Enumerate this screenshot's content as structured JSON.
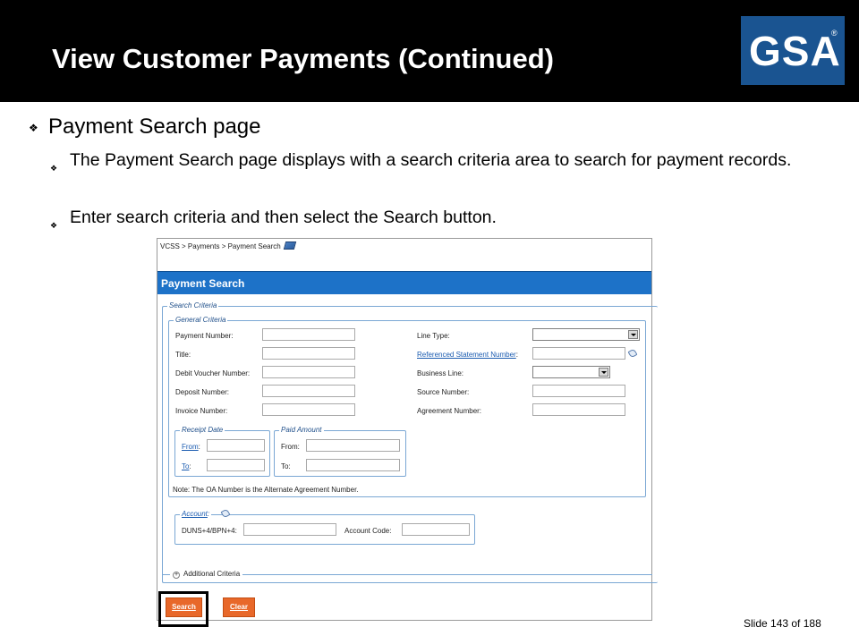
{
  "slide": {
    "title": "View Customer Payments (Continued)",
    "logo_text": "GSA",
    "logo_mark": "®",
    "bullet_main": "Payment Search page",
    "bullet_sub1": "The Payment Search page displays with a search criteria area to search for payment records.",
    "bullet_sub2": "Enter search criteria and then select the Search button.",
    "bullet_glyph": "❖",
    "footer": "Slide 143 of 188"
  },
  "screen": {
    "breadcrumb": "VCSS > Payments > Payment Search",
    "page_title": "Payment Search",
    "search_criteria_legend": "Search Criteria",
    "general_criteria_legend": "General Criteria",
    "left_fields": [
      {
        "label": "Payment Number:",
        "value": ""
      },
      {
        "label": "Title:",
        "value": ""
      },
      {
        "label": "Debit Voucher Number:",
        "value": ""
      },
      {
        "label": "Deposit Number:",
        "value": ""
      },
      {
        "label": "Invoice Number:",
        "value": ""
      }
    ],
    "right_fields": {
      "line_type": "Line Type:",
      "ref_statement": "Referenced Statement Number",
      "ref_colon": ":",
      "business_line": "Business Line:",
      "source_number": "Source Number:",
      "agreement_number": "Agreement Number:"
    },
    "receipt_date": {
      "legend": "Receipt Date",
      "from": "From",
      "to": "To",
      "colon": ":"
    },
    "paid_amount": {
      "legend": "Paid Amount",
      "from": "From:",
      "to": "To:"
    },
    "note": "Note: The OA Number is the Alternate Agreement Number.",
    "account": {
      "legend": "Account",
      "colon": ":",
      "duns_label": "DUNS+4/BPN+4:",
      "code_label": "Account Code:"
    },
    "additional_criteria": "Additional Criteria",
    "search_button": "Search",
    "clear_button": "Clear"
  }
}
